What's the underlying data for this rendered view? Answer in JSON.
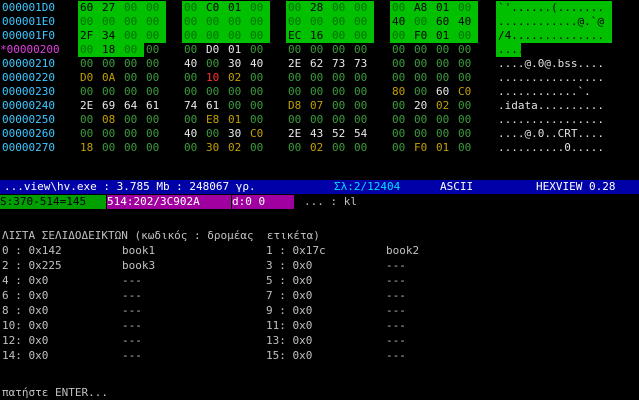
{
  "hex_rows": [
    {
      "addr": "000001D0",
      "current": false,
      "bytes": [
        "60",
        "27",
        "00",
        "00",
        "00",
        "C0",
        "01",
        "00",
        "00",
        "28",
        "00",
        "00",
        "00",
        "A8",
        "01",
        "00"
      ],
      "ascii": "`'......(.......",
      "green_from": 0,
      "green_to": 15
    },
    {
      "addr": "000001E0",
      "current": false,
      "bytes": [
        "00",
        "00",
        "00",
        "00",
        "00",
        "00",
        "00",
        "00",
        "00",
        "00",
        "00",
        "00",
        "40",
        "00",
        "60",
        "40"
      ],
      "ascii": "............@.`@",
      "green_from": 0,
      "green_to": 15
    },
    {
      "addr": "000001F0",
      "current": false,
      "bytes": [
        "2F",
        "34",
        "00",
        "00",
        "00",
        "00",
        "00",
        "00",
        "EC",
        "16",
        "00",
        "00",
        "00",
        "F0",
        "01",
        "00"
      ],
      "ascii": "/4..............",
      "green_from": 0,
      "green_to": 15
    },
    {
      "addr": "*00000200",
      "current": true,
      "bytes": [
        "00",
        "18",
        "00",
        "00",
        "00",
        "D0",
        "01",
        "00",
        "00",
        "00",
        "00",
        "00",
        "00",
        "00",
        "00",
        "00"
      ],
      "ascii": "................",
      "green_from": 0,
      "green_to": 2
    },
    {
      "addr": "00000210",
      "current": false,
      "bytes": [
        "00",
        "00",
        "00",
        "00",
        "40",
        "00",
        "30",
        "40",
        "2E",
        "62",
        "73",
        "73",
        "00",
        "00",
        "00",
        "00"
      ],
      "ascii": "....@.0@.bss....",
      "green_from": -1,
      "green_to": -1
    },
    {
      "addr": "00000220",
      "current": false,
      "bytes": [
        "D0",
        "0A",
        "00",
        "00",
        "00",
        "10",
        "02",
        "00",
        "00",
        "00",
        "00",
        "00",
        "00",
        "00",
        "00",
        "00"
      ],
      "ascii": "................",
      "green_from": -1,
      "green_to": -1
    },
    {
      "addr": "00000230",
      "current": false,
      "bytes": [
        "00",
        "00",
        "00",
        "00",
        "00",
        "00",
        "00",
        "00",
        "00",
        "00",
        "00",
        "00",
        "80",
        "00",
        "60",
        "C0"
      ],
      "ascii": "............`.",
      "green_from": -1,
      "green_to": -1
    },
    {
      "addr": "00000240",
      "current": false,
      "bytes": [
        "2E",
        "69",
        "64",
        "61",
        "74",
        "61",
        "00",
        "00",
        "D8",
        "07",
        "00",
        "00",
        "00",
        "20",
        "02",
        "00"
      ],
      "ascii": ".idata..........",
      "green_from": -1,
      "green_to": -1
    },
    {
      "addr": "00000250",
      "current": false,
      "bytes": [
        "00",
        "08",
        "00",
        "00",
        "00",
        "E8",
        "01",
        "00",
        "00",
        "00",
        "00",
        "00",
        "00",
        "00",
        "00",
        "00"
      ],
      "ascii": "................",
      "green_from": -1,
      "green_to": -1
    },
    {
      "addr": "00000260",
      "current": false,
      "bytes": [
        "00",
        "00",
        "00",
        "00",
        "40",
        "00",
        "30",
        "C0",
        "2E",
        "43",
        "52",
        "54",
        "00",
        "00",
        "00",
        "00"
      ],
      "ascii": "....@.0..CRT....",
      "green_from": -1,
      "green_to": -1
    },
    {
      "addr": "00000270",
      "current": false,
      "bytes": [
        "18",
        "00",
        "00",
        "00",
        "00",
        "30",
        "02",
        "00",
        "00",
        "02",
        "00",
        "00",
        "00",
        "F0",
        "01",
        "00"
      ],
      "ascii": "..........0.....",
      "green_from": -1,
      "green_to": -1
    }
  ],
  "colors": {
    "green": "#00c000",
    "status_bg": "#0000a8",
    "addr": "#3ec8ff",
    "current_addr": "#e040e0"
  },
  "status": {
    "file": "...view\\hv.exe : 3.785 Mb : 248067 γρ.",
    "page": "Σλ:2/12404",
    "mode": "ASCII",
    "app": "HEXVIEW 0.28"
  },
  "cmdline": {
    "sel": "S:370-514=145",
    "pos": "514:202/3C902A",
    "delta": "d:0 0",
    "prompt": "... : kl"
  },
  "bookmarks": {
    "heading": "ΛΙΣΤΑ ΣΕΛΙΔΟΔΕΙΚΤΩΝ (κωδικός : δρομέας  ετικέτα)",
    "left": [
      {
        "id": "0 : 0x142",
        "label": "book1"
      },
      {
        "id": "2 : 0x225",
        "label": "book3"
      },
      {
        "id": "4 : 0x0",
        "label": "---"
      },
      {
        "id": "6 : 0x0",
        "label": "---"
      },
      {
        "id": "8 : 0x0",
        "label": "---"
      },
      {
        "id": "10: 0x0",
        "label": "---"
      },
      {
        "id": "12: 0x0",
        "label": "---"
      },
      {
        "id": "14: 0x0",
        "label": "---"
      }
    ],
    "right": [
      {
        "id": "1 : 0x17c",
        "label": "book2"
      },
      {
        "id": "3 : 0x0",
        "label": "---"
      },
      {
        "id": "5 : 0x0",
        "label": "---"
      },
      {
        "id": "7 : 0x0",
        "label": "---"
      },
      {
        "id": "9 : 0x0",
        "label": "---"
      },
      {
        "id": "11: 0x0",
        "label": "---"
      },
      {
        "id": "13: 0x0",
        "label": "---"
      },
      {
        "id": "15: 0x0",
        "label": "---"
      }
    ],
    "footer": "πατήστε ENTER..."
  }
}
